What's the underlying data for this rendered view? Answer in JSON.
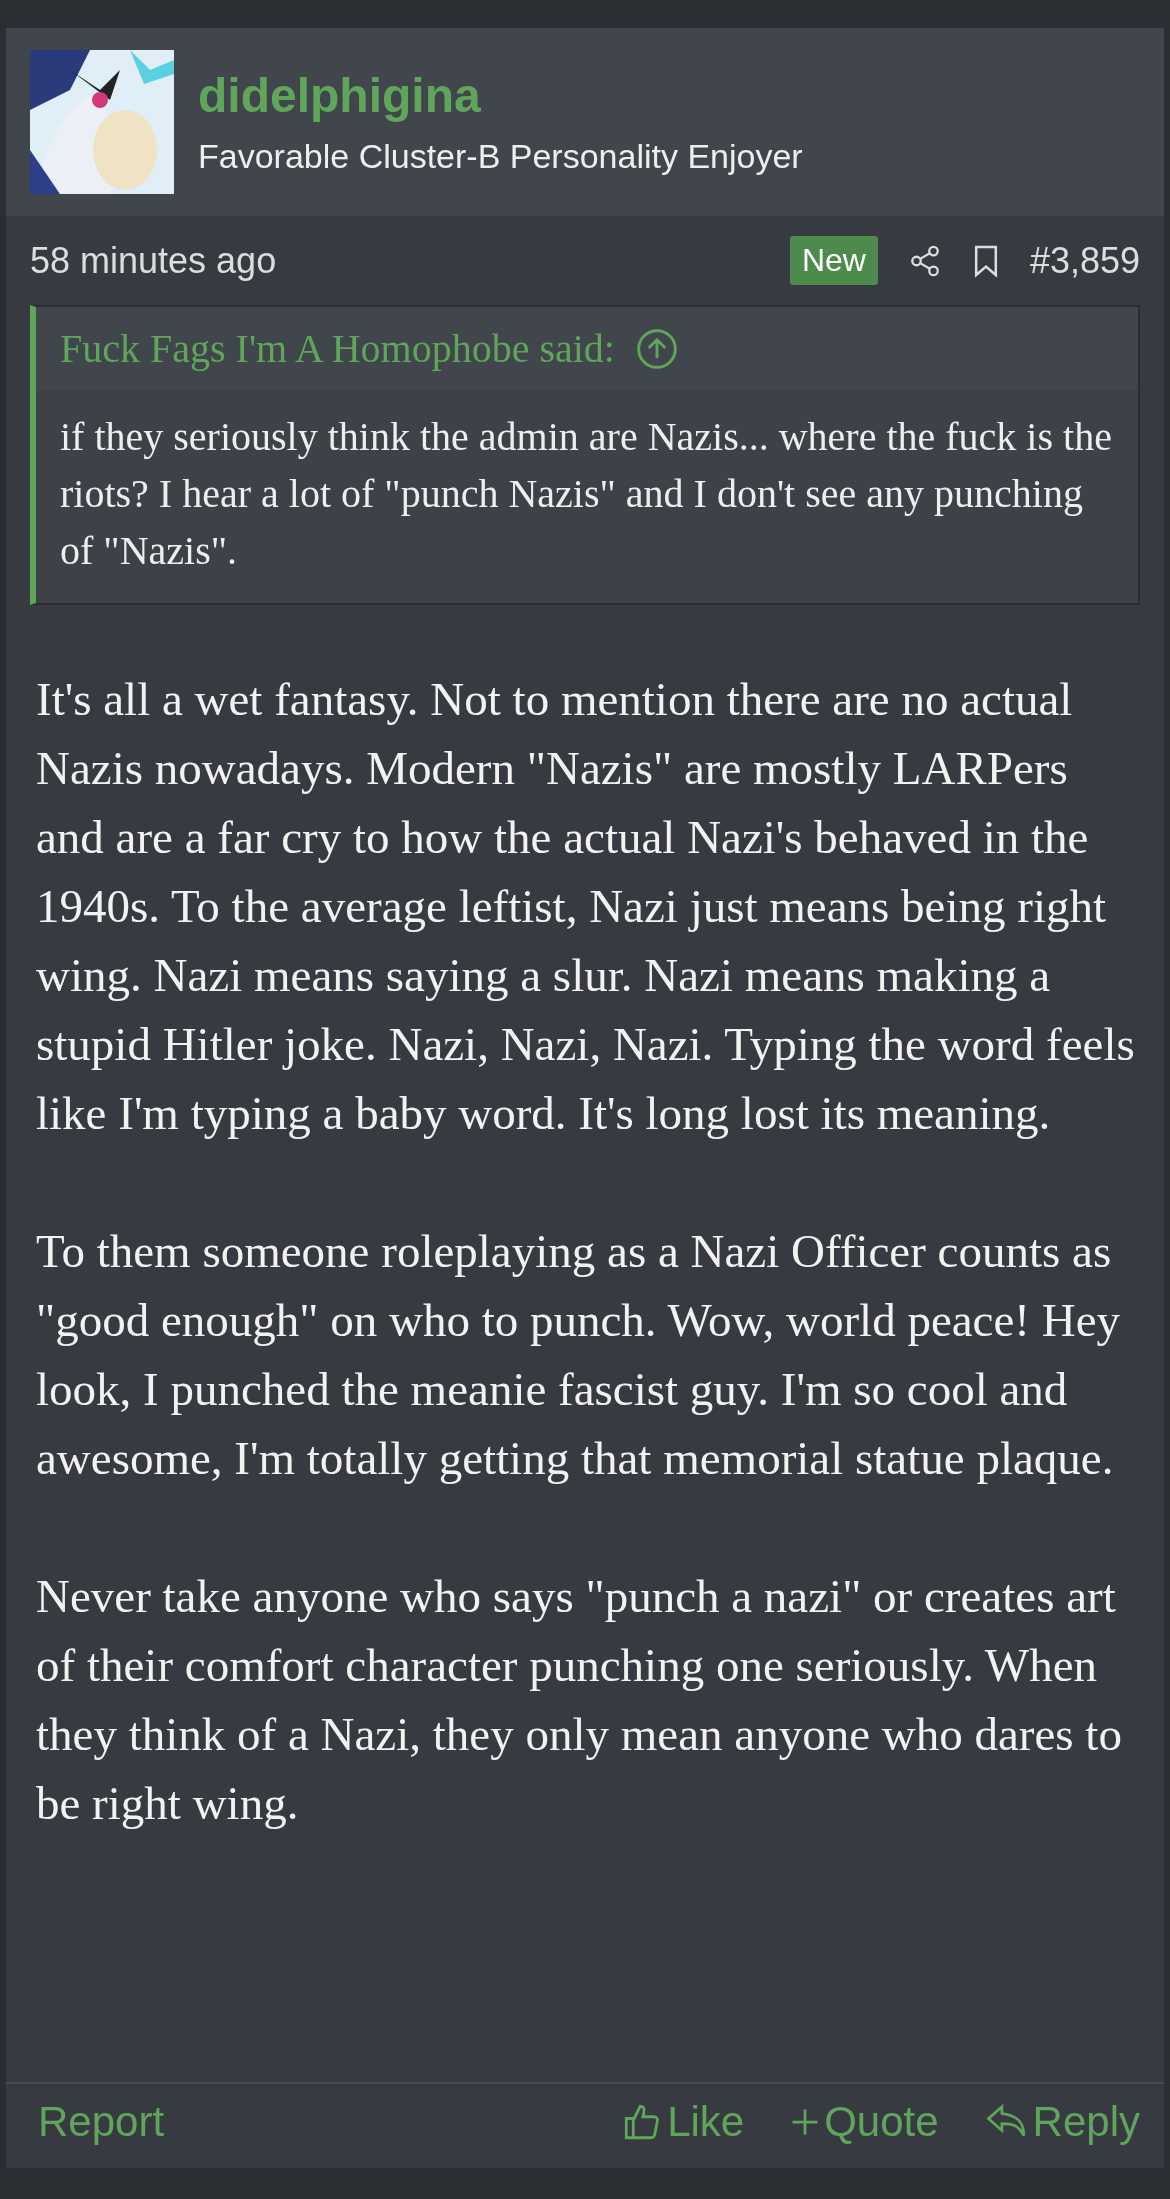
{
  "author": {
    "name": "didelphigina",
    "title": "Favorable Cluster-B Personality Enjoyer"
  },
  "meta": {
    "time": "58 minutes ago",
    "badge": "New",
    "post_number": "#3,859"
  },
  "quote": {
    "attribution": "Fuck Fags I'm A Homophobe said:",
    "text": "if they seriously think the admin are Nazis... where the fuck is the riots? I hear a lot of \"punch Nazis\" and I don't see any punching of \"Nazis\"."
  },
  "paragraphs": [
    "It's all a wet fantasy. Not to mention there are no actual Nazis nowadays. Modern \"Nazis\" are mostly LARPers and are a far cry to how the actual Nazi's behaved in the 1940s. To the average leftist, Nazi just means being right wing. Nazi means saying a slur. Nazi means making a stupid Hitler joke. Nazi, Nazi, Nazi. Typing the word feels like I'm typing a baby word. It's long lost its meaning.",
    "To them someone roleplaying as a Nazi Officer counts as \"good enough\" on who to punch. Wow, world peace! Hey look, I punched the meanie fascist guy. I'm so cool and awesome, I'm totally getting that memorial statue plaque.",
    "Never take anyone who says \"punch a nazi\" or creates art of their comfort character punching one seriously. When they think of a Nazi, they only mean anyone who dares to be right wing."
  ],
  "footer": {
    "report": "Report",
    "actions": [
      {
        "kind": "like",
        "label": "Like"
      },
      {
        "kind": "quote",
        "label": "Quote"
      },
      {
        "kind": "reply",
        "label": "Reply"
      }
    ]
  }
}
